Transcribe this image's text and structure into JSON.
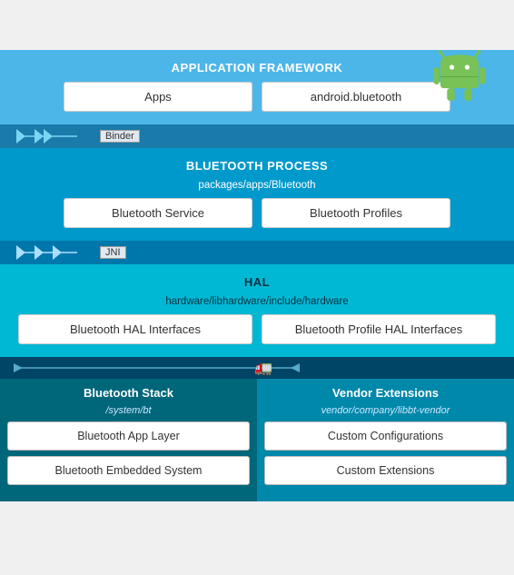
{
  "android_logo": {
    "alt": "Android Logo"
  },
  "sections": {
    "app_framework": {
      "title": "APPLICATION FRAMEWORK",
      "boxes": [
        "Apps",
        "android.bluetooth"
      ]
    },
    "binder": "Binder",
    "bluetooth_process": {
      "title": "BLUETOOTH PROCESS",
      "subtitle": "packages/apps/Bluetooth",
      "boxes": [
        "Bluetooth Service",
        "Bluetooth Profiles"
      ]
    },
    "jni": "JNI",
    "hal": {
      "title": "HAL",
      "subtitle": "hardware/libhardware/include/hardware",
      "boxes": [
        "Bluetooth HAL Interfaces",
        "Bluetooth Profile HAL Interfaces"
      ]
    },
    "bluetooth_stack": {
      "title": "Bluetooth Stack",
      "subtitle": "/system/bt",
      "boxes": [
        "Bluetooth App Layer",
        "Bluetooth Embedded System"
      ]
    },
    "vendor_extensions": {
      "title": "Vendor Extensions",
      "subtitle": "vendor/company/libbt-vendor",
      "boxes": [
        "Custom Configurations",
        "Custom Extensions"
      ]
    }
  }
}
